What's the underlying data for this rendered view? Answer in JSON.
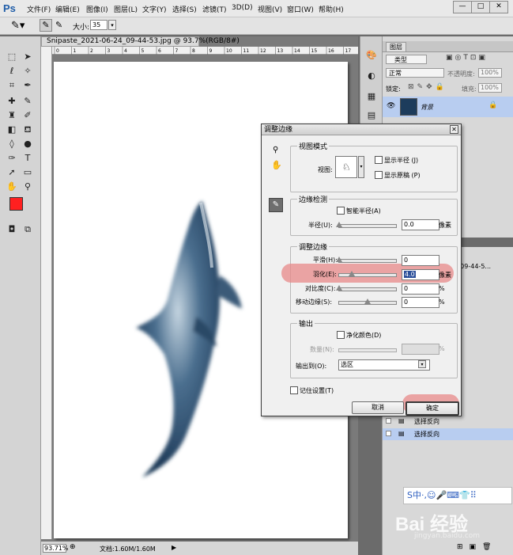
{
  "app": {
    "logo": "Ps"
  },
  "menu": [
    "文件(F)",
    "编辑(E)",
    "图像(I)",
    "图层(L)",
    "文字(Y)",
    "选择(S)",
    "滤镜(T)",
    "3D(D)",
    "视图(V)",
    "窗口(W)",
    "帮助(H)"
  ],
  "options": {
    "size_label": "大小:",
    "size_value": "35"
  },
  "document": {
    "tab_title": "Snipaste_2021-06-24_09-44-53.jpg @ 93.7%(RGB/8#)",
    "zoom": "93.71%",
    "doc_info": "文档:1.60M/1.60M"
  },
  "ruler_top": [
    "0",
    "1",
    "2",
    "3",
    "4",
    "5",
    "6",
    "7",
    "8",
    "9",
    "10",
    "11",
    "12",
    "13",
    "14",
    "15",
    "16",
    "17"
  ],
  "layers": {
    "tab": "图层",
    "kind": "类型",
    "blend": "正常",
    "opacity_label": "不透明度:",
    "opacity": "100%",
    "lock_label": "锁定:",
    "fill_label": "填充:",
    "fill": "100%",
    "layer_name": "背景"
  },
  "history": {
    "title_fragment": "24_09-44-5...",
    "items": [
      "选择反向",
      "选择反向"
    ]
  },
  "dialog": {
    "title": "调整边缘",
    "view_mode": {
      "title": "视图模式",
      "view_label": "视图:",
      "show_radius": "显示半径 (J)",
      "show_original": "显示原稿 (P)"
    },
    "edge_detect": {
      "title": "边缘检测",
      "smart_radius": "智能半径(A)",
      "radius_label": "半径(U):",
      "radius_value": "0.0",
      "radius_unit": "像素"
    },
    "adjust": {
      "title": "调整边缘",
      "smooth_label": "平滑(H):",
      "smooth_value": "0",
      "feather_label": "羽化(E):",
      "feather_value": "4.0",
      "feather_unit": "像素",
      "contrast_label": "对比度(C):",
      "contrast_value": "0",
      "contrast_unit": "%",
      "shift_label": "移动边缘(S):",
      "shift_value": "0",
      "shift_unit": "%"
    },
    "output": {
      "title": "输出",
      "decontaminate": "净化颜色(D)",
      "amount_label": "数量(N):",
      "amount_unit": "%",
      "output_to_label": "输出到(O):",
      "output_to_value": "选区"
    },
    "remember": "记住设置(T)",
    "cancel": "取消",
    "ok": "确定"
  },
  "ime": {
    "icons": "S中·,☺🎤⌨👕⠿"
  },
  "watermark": {
    "text": "Bai 经验",
    "url": "jingyan.baidu.com"
  },
  "colors": {
    "highlight": "#e88a8a",
    "foreground": "#ff2020",
    "accent_blue": "#b8cdf0"
  }
}
